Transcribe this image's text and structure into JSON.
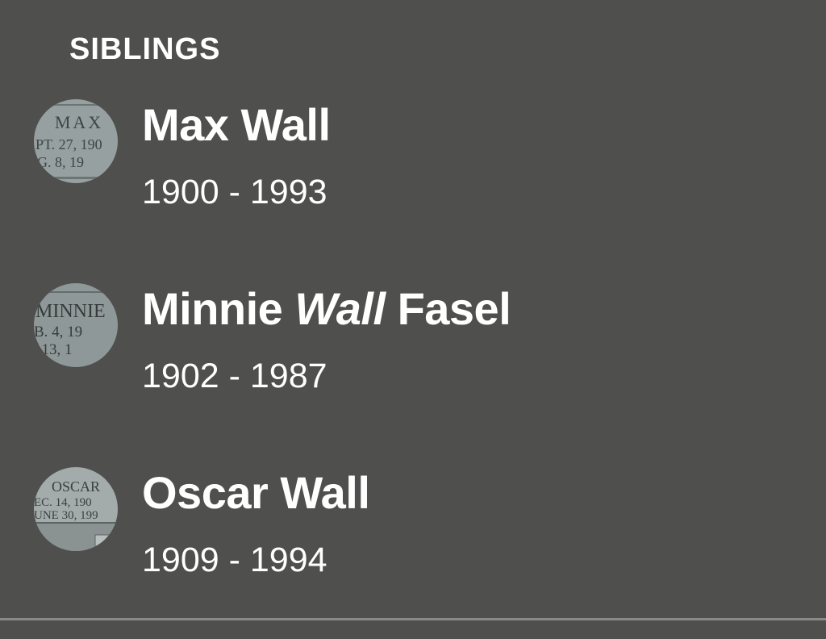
{
  "section": {
    "title": "SIBLINGS"
  },
  "siblings": [
    {
      "first_name": "Max",
      "maiden_name": "",
      "last_name": "Wall",
      "dates": "1900 - 1993",
      "photo": {
        "icon": "headstone-photo",
        "lines": [
          "MAX",
          "PT. 27, 190",
          "G. 8, 19"
        ]
      }
    },
    {
      "first_name": "Minnie",
      "maiden_name": "Wall",
      "last_name": "Fasel",
      "dates": "1902 - 1987",
      "photo": {
        "icon": "headstone-photo",
        "lines": [
          "MINNIE",
          "B.  4,  19",
          ".  13,  1"
        ]
      }
    },
    {
      "first_name": "Oscar",
      "maiden_name": "",
      "last_name": "Wall",
      "dates": "1909 - 1994",
      "photo": {
        "icon": "headstone-photo",
        "lines": [
          "OSCAR",
          "EC.  14,  190",
          "UNE  30,  199"
        ]
      }
    }
  ],
  "colors": {
    "background": "#4f4f4e",
    "text": "#ffffff",
    "divider": "#8a8a89",
    "headstone": "#9ba3a3"
  }
}
